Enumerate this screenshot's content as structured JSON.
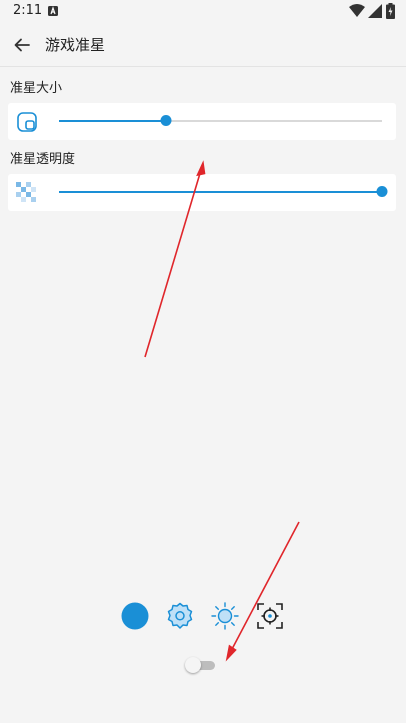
{
  "status_bar": {
    "time": "2:11",
    "icons": [
      "a-notification-icon",
      "wifi-icon",
      "signal-icon",
      "battery-charging-icon"
    ]
  },
  "toolbar": {
    "title": "游戏准星",
    "back_icon": "arrow-left-icon"
  },
  "sections": {
    "size": {
      "label": "准星大小",
      "icon": "crosshair-size-icon",
      "value": 0.33
    },
    "opacity": {
      "label": "准星透明度",
      "icon": "checkerboard-opacity-icon",
      "value": 1.0
    }
  },
  "crosshair_styles": [
    "filled-circle-icon",
    "gear-badge-icon",
    "sun-icon",
    "target-reticle-icon"
  ],
  "toggle": {
    "on": false
  },
  "colors": {
    "accent": "#1a8fd6",
    "annotation": "#e0262b",
    "background": "#f4f4f4"
  }
}
